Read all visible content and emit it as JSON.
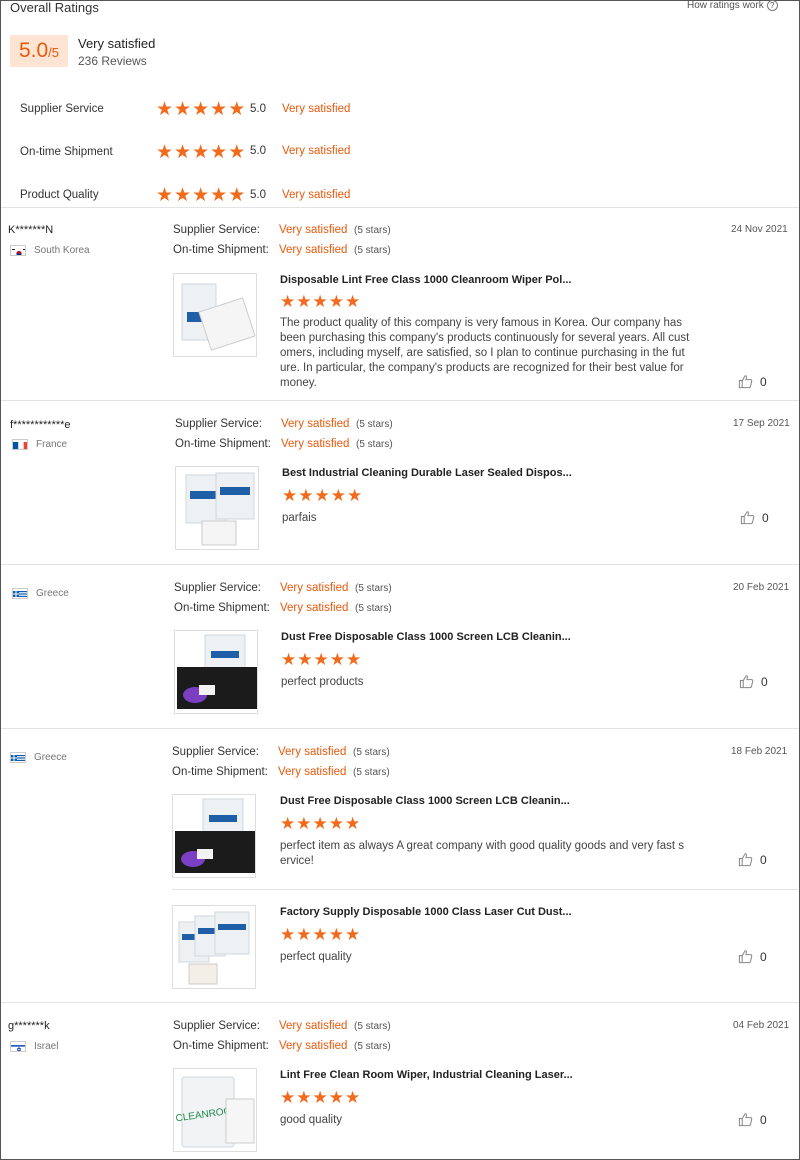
{
  "header": {
    "title": "Overall Ratings",
    "how_link": "How ratings work",
    "score": "5.0",
    "score_suffix": "/5",
    "summary_label": "Very satisfied",
    "reviews_count": "236 Reviews"
  },
  "categories": [
    {
      "label": "Supplier Service",
      "stars": 5,
      "score": "5.0",
      "text": "Very satisfied"
    },
    {
      "label": "On-time Shipment",
      "stars": 5,
      "score": "5.0",
      "text": "Very satisfied"
    },
    {
      "label": "Product Quality",
      "stars": 5,
      "score": "5.0",
      "text": "Very satisfied"
    }
  ],
  "labels": {
    "supplier_service": "Supplier Service:",
    "ontime_shipment": "On-time Shipment:",
    "very_satisfied": "Very satisfied",
    "five_stars": "(5 stars)"
  },
  "colors": {
    "accent": "#e8590c",
    "star": "#f26b1d",
    "score_bg": "#fde4d3"
  },
  "reviews": [
    {
      "user": "K*******N",
      "country": "South Korea",
      "flag": "flag-south-korea",
      "date": "24 Nov 2021",
      "products": [
        {
          "title": "Disposable Lint Free Class 1000 Cleanroom Wiper Pol...",
          "stars": 5,
          "text": "The product quality of this company is very famous in Korea.  Our company has been purchasing this company's products continuously for several years.  All customers, including myself, are satisfied, so I plan to continue purchasing in the future.  In particular, the company's products are recognized for their best value for money.",
          "likes": "0"
        }
      ]
    },
    {
      "user": "f************e",
      "country": "France",
      "flag": "flag-france",
      "date": "17 Sep 2021",
      "products": [
        {
          "title": "Best Industrial Cleaning Durable Laser Sealed Dispos...",
          "stars": 5,
          "text": "parfais",
          "likes": "0"
        }
      ]
    },
    {
      "user": "",
      "country": "Greece",
      "flag": "flag-greece",
      "date": "20 Feb 2021",
      "products": [
        {
          "title": "Dust Free Disposable Class 1000 Screen LCB Cleanin...",
          "stars": 5,
          "text": "perfect products",
          "likes": "0"
        }
      ]
    },
    {
      "user": "",
      "country": "Greece",
      "flag": "flag-greece",
      "date": "18 Feb 2021",
      "products": [
        {
          "title": "Dust Free Disposable Class 1000 Screen LCB Cleanin...",
          "stars": 5,
          "text": "perfect item as always A great company with good quality goods and very fast service!",
          "likes": "0"
        },
        {
          "title": "Factory Supply Disposable 1000 Class Laser Cut Dust...",
          "stars": 5,
          "text": "perfect quality",
          "likes": "0"
        }
      ]
    },
    {
      "user": "g*******k",
      "country": "Israel",
      "flag": "flag-israel",
      "date": "04 Feb 2021",
      "products": [
        {
          "title": "Lint Free Clean Room Wiper, Industrial Cleaning Laser...",
          "stars": 5,
          "text": "good quality",
          "likes": "0"
        }
      ]
    }
  ]
}
